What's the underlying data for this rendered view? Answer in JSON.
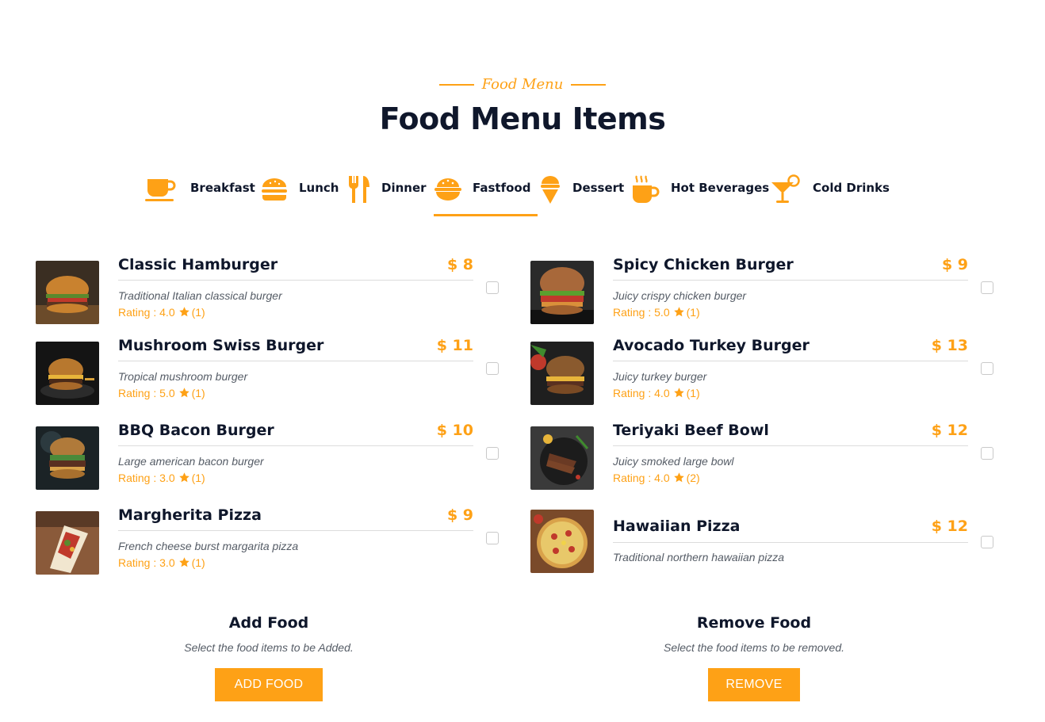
{
  "header": {
    "kicker": "Food Menu",
    "title": "Food Menu Items"
  },
  "tabs": [
    {
      "label": "Breakfast",
      "icon": "coffee-cup-icon"
    },
    {
      "label": "Lunch",
      "icon": "hamburger-icon"
    },
    {
      "label": "Dinner",
      "icon": "utensils-icon"
    },
    {
      "label": "Fastfood",
      "icon": "bowl-rice-icon",
      "active": true
    },
    {
      "label": "Dessert",
      "icon": "ice-cream-icon"
    },
    {
      "label": "Hot Beverages",
      "icon": "mug-hot-icon"
    },
    {
      "label": "Cold Drinks",
      "icon": "cocktail-icon"
    }
  ],
  "items_left": [
    {
      "name": "Classic Hamburger",
      "price": "$ 8",
      "description": "Traditional Italian classical burger",
      "rating": "Rating : 4.0",
      "count": "(1)"
    },
    {
      "name": "Mushroom Swiss Burger",
      "price": "$ 11",
      "description": "Tropical mushroom burger",
      "rating": "Rating : 5.0",
      "count": "(1)"
    },
    {
      "name": "BBQ Bacon Burger",
      "price": "$ 10",
      "description": "Large american bacon burger",
      "rating": "Rating : 3.0",
      "count": "(1)"
    },
    {
      "name": "Margherita Pizza",
      "price": "$ 9",
      "description": "French cheese burst margarita pizza",
      "rating": "Rating : 3.0",
      "count": "(1)"
    }
  ],
  "items_right": [
    {
      "name": "Spicy Chicken Burger",
      "price": "$ 9",
      "description": "Juicy crispy chicken burger",
      "rating": "Rating : 5.0",
      "count": "(1)"
    },
    {
      "name": "Avocado Turkey Burger",
      "price": "$ 13",
      "description": "Juicy turkey burger",
      "rating": "Rating : 4.0",
      "count": "(1)"
    },
    {
      "name": "Teriyaki Beef Bowl",
      "price": "$ 12",
      "description": "Juicy smoked large bowl",
      "rating": "Rating : 4.0",
      "count": "(2)"
    },
    {
      "name": "Hawaiian Pizza",
      "price": "$ 12",
      "description": "Traditional northern hawaiian pizza"
    }
  ],
  "add_section": {
    "title": "Add Food",
    "subtitle": "Select the food items to be Added.",
    "button": "ADD FOOD"
  },
  "remove_section": {
    "title": "Remove Food",
    "subtitle": "Select the food items to be removed.",
    "button": "REMOVE"
  },
  "colors": {
    "accent": "#fea116",
    "heading": "#0f172b",
    "muted": "#555c66"
  }
}
